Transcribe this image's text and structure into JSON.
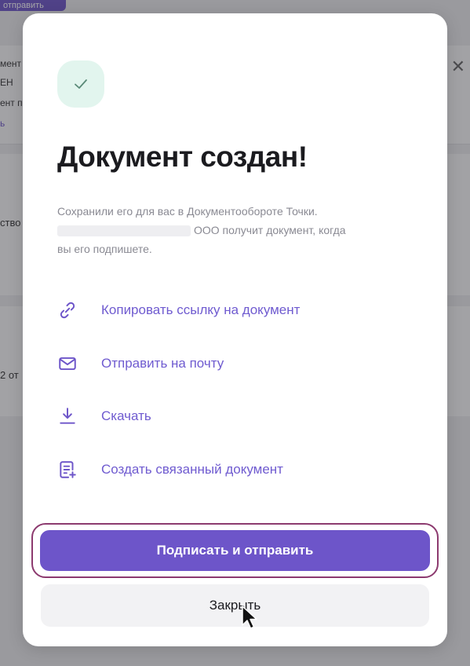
{
  "background": {
    "top_button_label": "отправить",
    "card_lines": [
      "мент",
      "ЕН",
      "ент п",
      "ь"
    ],
    "side_texts": [
      "ство",
      "2 от"
    ]
  },
  "modal": {
    "status_icon": "check-icon",
    "title": "Документ создан!",
    "description_line1": "Сохранили его для вас в Документообороте Точки.",
    "description_line2_suffix": "ООО получит документ, когда",
    "description_line3": "вы его подпишете.",
    "actions": [
      {
        "icon": "link-icon",
        "label": "Копировать ссылку на документ"
      },
      {
        "icon": "mail-icon",
        "label": "Отправить на почту"
      },
      {
        "icon": "download-icon",
        "label": "Скачать"
      },
      {
        "icon": "new-document-icon",
        "label": "Создать связанный документ"
      }
    ],
    "primary_button": "Подписать и отправить",
    "secondary_button": "Закрыть"
  },
  "colors": {
    "accent": "#6d55c9",
    "success_bg": "#e2f5ee",
    "success_check": "#5a8a78",
    "focus_ring": "#8c3a6f"
  }
}
